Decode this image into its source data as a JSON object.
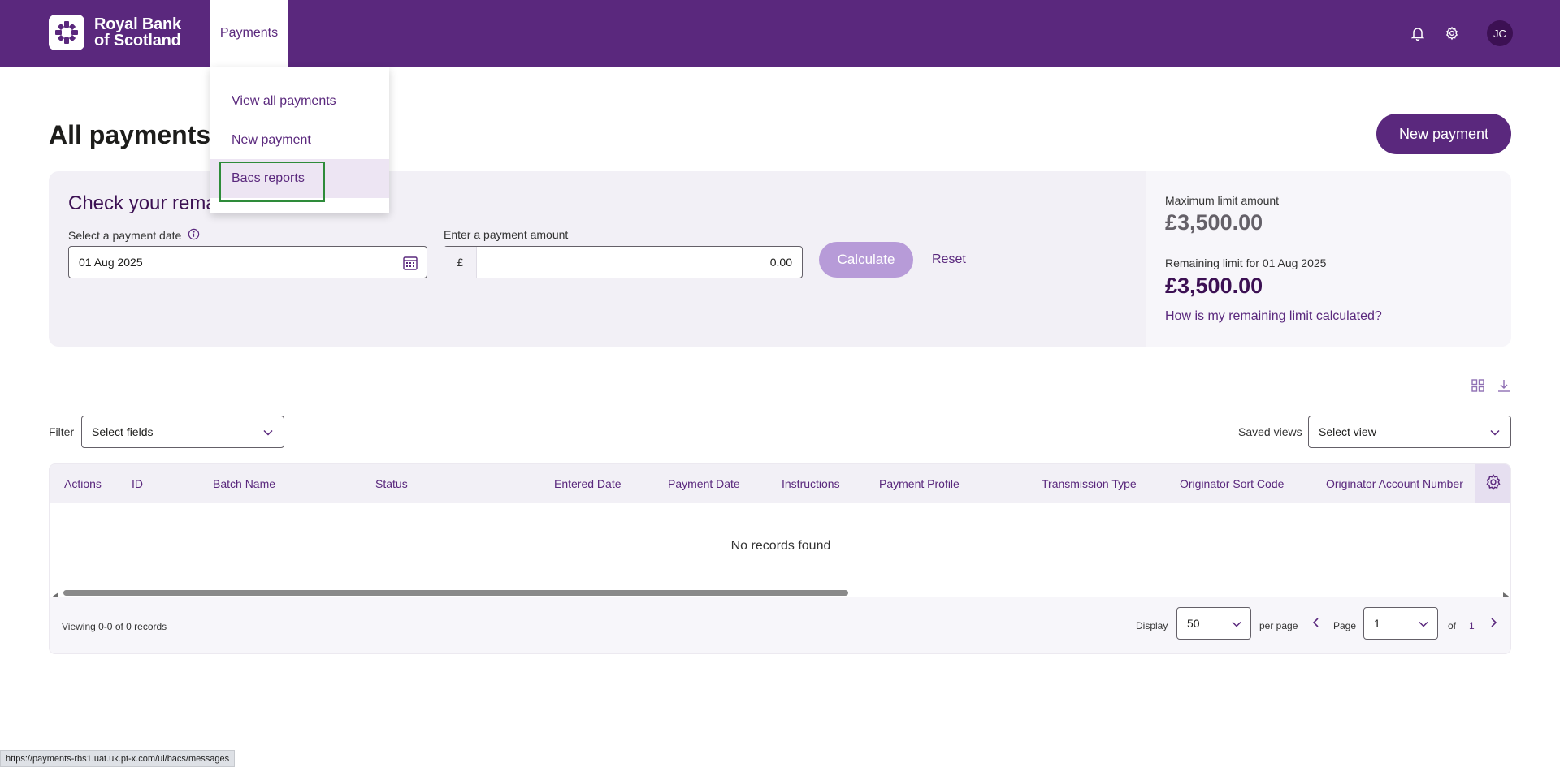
{
  "header": {
    "logo_line1": "Royal Bank",
    "logo_line2": "of Scotland",
    "nav_payments": "Payments",
    "avatar_initials": "JC",
    "brand_color": "#5a287d"
  },
  "menu": {
    "items": [
      {
        "label": "View all payments"
      },
      {
        "label": "New payment"
      },
      {
        "label": "Bacs reports"
      }
    ]
  },
  "page": {
    "title": "All payments",
    "new_payment_label": "New payment"
  },
  "limit_panel": {
    "title": "Check your rema",
    "date_label": "Select a payment date",
    "date_value": "01 Aug 2025",
    "amount_label": "Enter a payment amount",
    "currency_symbol": "£",
    "amount_value": "0.00",
    "calculate_label": "Calculate",
    "reset_label": "Reset",
    "max_label": "Maximum limit amount",
    "max_value": "£3,500.00",
    "remaining_label": "Remaining limit for 01 Aug 2025",
    "remaining_value": "£3,500.00",
    "help_link": "How is my remaining limit calculated?"
  },
  "filters": {
    "filter_label": "Filter",
    "filter_placeholder": "Select fields",
    "saved_views_label": "Saved views",
    "saved_views_placeholder": "Select view"
  },
  "table": {
    "columns": [
      "Actions",
      "ID",
      "Batch Name",
      "Status",
      "Entered Date",
      "Payment Date",
      "Instructions",
      "Payment Profile",
      "Transmission Type",
      "Originator Sort Code",
      "Originator Account Number"
    ],
    "empty_text": "No records found"
  },
  "pagination": {
    "viewing_text": "Viewing 0-0 of 0 records",
    "display_label": "Display",
    "per_page_value": "50",
    "per_page_label": "per page",
    "page_label": "Page",
    "page_value": "1",
    "of_label": "of",
    "total_pages": "1"
  },
  "statusbar": {
    "url": "https://payments-rbs1.uat.uk.pt-x.com/ui/bacs/messages"
  }
}
